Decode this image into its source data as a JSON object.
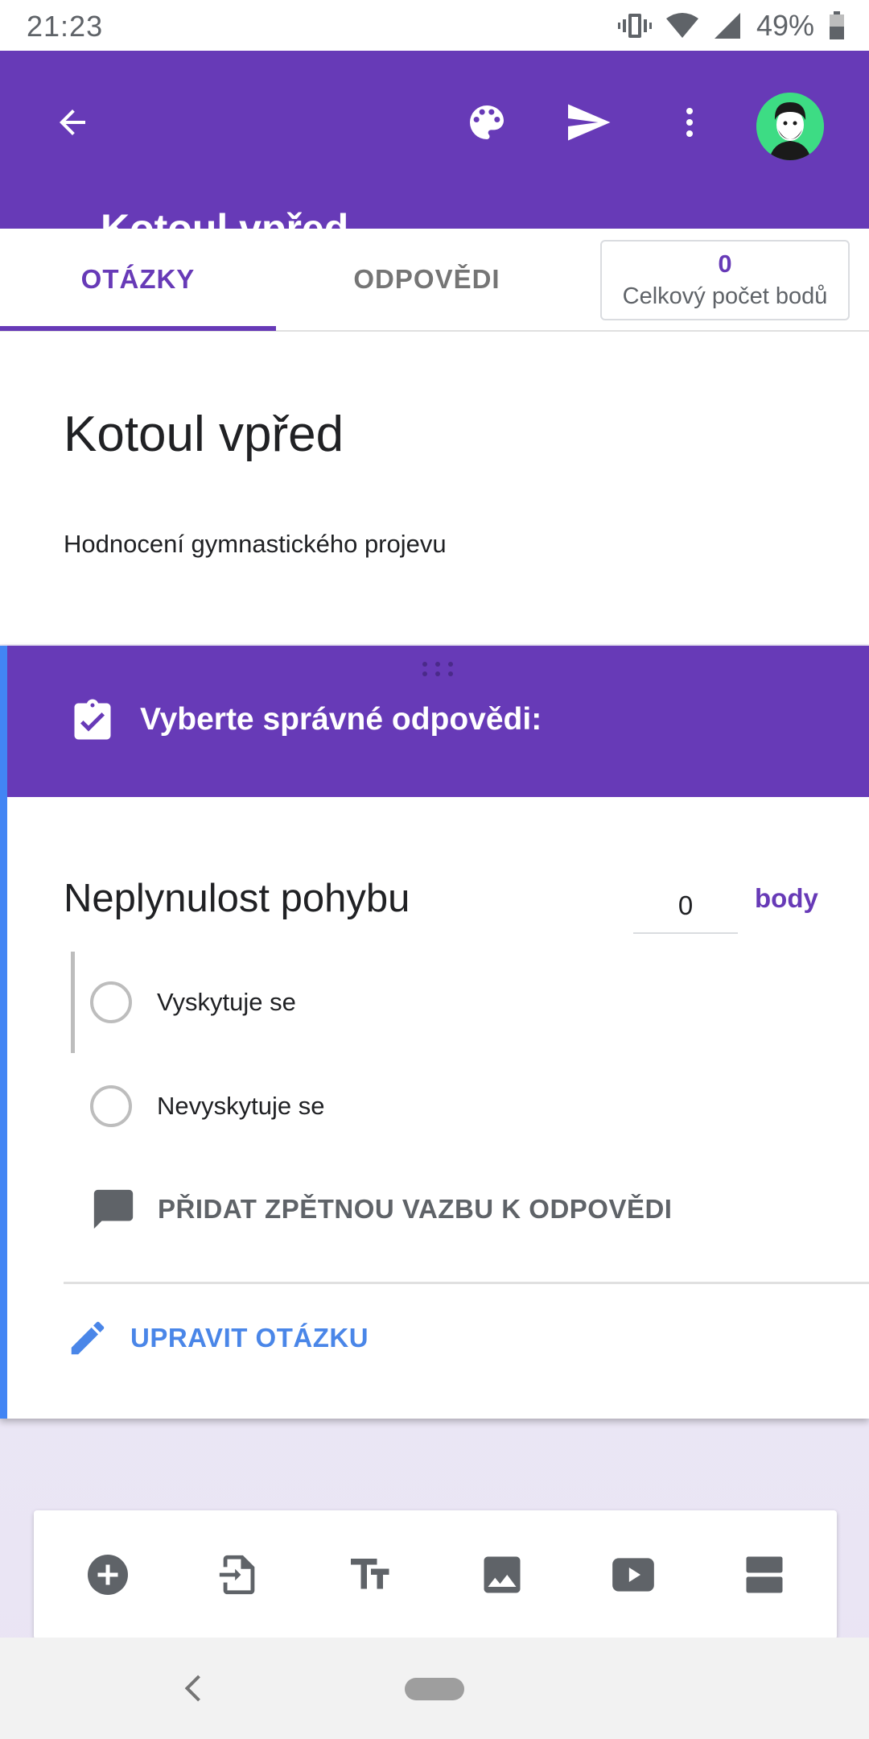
{
  "status_bar": {
    "time": "21:23",
    "battery": "49%",
    "icons": [
      "vibrate-icon",
      "wifi-icon",
      "signal-icon",
      "battery-icon"
    ]
  },
  "app_bar": {
    "title": "Kotoul vpřed",
    "color": "#673ab7",
    "icons": [
      "back-arrow-icon",
      "palette-icon",
      "send-icon",
      "more-vert-icon",
      "avatar"
    ]
  },
  "tabs": {
    "questions": "OTÁZKY",
    "responses": "ODPOVĚDI",
    "total_points_value": "0",
    "total_points_label": "Celkový počet bodů"
  },
  "form": {
    "title": "Kotoul vpřed",
    "description": "Hodnocení gymnastického projevu"
  },
  "question_card": {
    "answer_key_title": "Vyberte správné odpovědi:",
    "question": "Neplynulost pohybu",
    "points_value": "0",
    "points_unit": "body",
    "options": [
      "Vyskytuje se",
      "Nevyskytuje se"
    ],
    "feedback_label": "PŘIDAT ZPĚTNOU VAZBU K ODPOVĚDI",
    "edit_label": "UPRAVIT OTÁZKU",
    "accent_color": "#4285f4"
  },
  "toolbar": {
    "icons": [
      "add-question-icon",
      "import-questions-icon",
      "add-title-icon",
      "add-image-icon",
      "add-video-icon",
      "add-section-icon"
    ]
  }
}
